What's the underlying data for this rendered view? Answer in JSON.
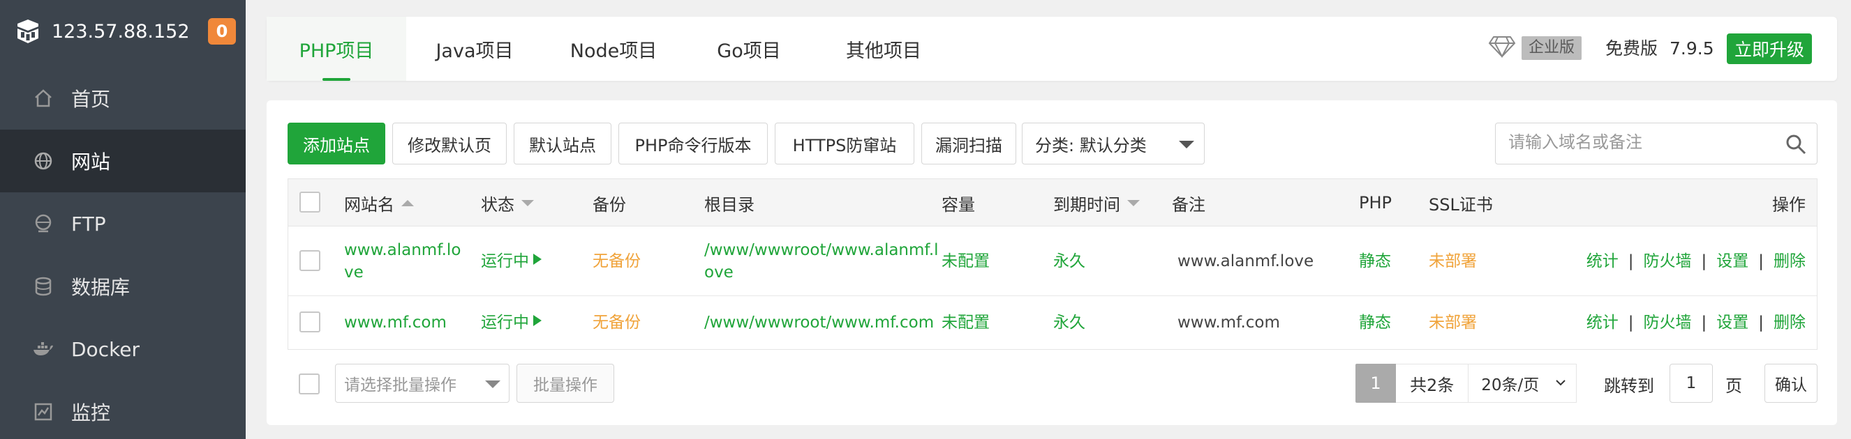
{
  "sidebar": {
    "ip": "123.57.88.152",
    "badge": "0",
    "items": [
      {
        "label": "首页",
        "icon": "home-icon"
      },
      {
        "label": "网站",
        "icon": "globe-icon"
      },
      {
        "label": "FTP",
        "icon": "ftp-icon"
      },
      {
        "label": "数据库",
        "icon": "database-icon"
      },
      {
        "label": "Docker",
        "icon": "docker-icon"
      },
      {
        "label": "监控",
        "icon": "monitor-icon"
      }
    ]
  },
  "topbar": {
    "tabs": [
      {
        "label": "PHP项目"
      },
      {
        "label": "Java项目"
      },
      {
        "label": "Node项目"
      },
      {
        "label": "Go项目"
      },
      {
        "label": "其他项目"
      }
    ],
    "enterprise_label": "企业版",
    "free_label": "免费版",
    "version": "7.9.5",
    "upgrade_label": "立即升级"
  },
  "toolbar": {
    "add_site": "添加站点",
    "edit_default_page": "修改默认页",
    "default_site": "默认站点",
    "php_cli": "PHP命令行版本",
    "https_guard": "HTTPS防窜站",
    "vuln_scan": "漏洞扫描",
    "category": "分类: 默认分类",
    "search_placeholder": "请输入域名或备注"
  },
  "table": {
    "headers": {
      "name": "网站名",
      "status": "状态",
      "backup": "备份",
      "root": "根目录",
      "capacity": "容量",
      "expire": "到期时间",
      "remark": "备注",
      "php": "PHP",
      "ssl": "SSL证书",
      "actions": "操作"
    },
    "rows": [
      {
        "name_line1": "www.alanmf.lo",
        "name_line2": "ve",
        "status": "运行中",
        "backup": "无备份",
        "root_line1": "/www/wwwroot/www.alanmf.l",
        "root_line2": "ove",
        "capacity": "未配置",
        "expire": "永久",
        "remark": "www.alanmf.love",
        "php": "静态",
        "ssl": "未部署"
      },
      {
        "name_line1": "www.mf.com",
        "name_line2": "",
        "status": "运行中",
        "backup": "无备份",
        "root_line1": "/www/wwwroot/www.mf.com",
        "root_line2": "",
        "capacity": "未配置",
        "expire": "永久",
        "remark": "www.mf.com",
        "php": "静态",
        "ssl": "未部署"
      }
    ],
    "actions": {
      "stats": "统计",
      "firewall": "防火墙",
      "settings": "设置",
      "delete": "删除",
      "separator": "|"
    }
  },
  "footer": {
    "batch_placeholder": "请选择批量操作",
    "batch_button": "批量操作",
    "current_page": "1",
    "total": "共2条",
    "page_size": "20条/页",
    "jump_label": "跳转到",
    "jump_value": "1",
    "page_label": "页",
    "confirm": "确认"
  },
  "colors": {
    "accent": "#20a53a",
    "warning": "#f0a33a",
    "sidebar": "#3c444d",
    "sidebar_active": "#2a2f35"
  }
}
